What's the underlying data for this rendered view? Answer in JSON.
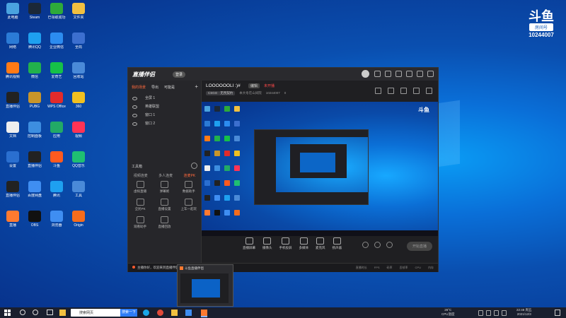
{
  "desktop": {
    "icons": [
      {
        "label": "此电脑",
        "color": "#4aa3df"
      },
      {
        "label": "Steam",
        "color": "#1b2838"
      },
      {
        "label": "已领取成功",
        "color": "#2eaa3a"
      },
      {
        "label": "文件夹",
        "color": "#f2c040"
      },
      {
        "label": "网络",
        "color": "#2b7bd6"
      },
      {
        "label": "腾讯QQ",
        "color": "#1ea0f0"
      },
      {
        "label": "企业微信",
        "color": "#2c8cf0"
      },
      {
        "label": "全局",
        "color": "#3c6fcf"
      },
      {
        "label": "腾讯视频",
        "color": "#ff7a16"
      },
      {
        "label": "微信",
        "color": "#22b14c"
      },
      {
        "label": "爱奇艺",
        "color": "#16c048"
      },
      {
        "label": "回收站",
        "color": "#4a8ad8"
      },
      {
        "label": "直播伴侣",
        "color": "#222"
      },
      {
        "label": "PUBG",
        "color": "#c8952a"
      },
      {
        "label": "WPS Office",
        "color": "#e22b2b"
      },
      {
        "label": "360",
        "color": "#f0c020"
      },
      {
        "label": "文档",
        "color": "#eeeeee"
      },
      {
        "label": "控制面板",
        "color": "#3d8ee0"
      },
      {
        "label": "应用",
        "color": "#22aa66"
      },
      {
        "label": "视频",
        "color": "#ff3355"
      },
      {
        "label": "设置",
        "color": "#2a6fd0"
      },
      {
        "label": "直播伴侣",
        "color": "#222"
      },
      {
        "label": "斗鱼",
        "color": "#ff5a1f"
      },
      {
        "label": "QQ音乐",
        "color": "#1fbf72"
      },
      {
        "label": "直播伴侣",
        "color": "#222"
      },
      {
        "label": "百度网盘",
        "color": "#3f8ef2"
      },
      {
        "label": "腾讯",
        "color": "#1ea0f0"
      },
      {
        "label": "工具",
        "color": "#4a8ad8"
      },
      {
        "label": "直播",
        "color": "#ff7a30"
      },
      {
        "label": "OBS",
        "color": "#111"
      },
      {
        "label": "浏览器",
        "color": "#3f8ef2"
      },
      {
        "label": "Origin",
        "color": "#f56c1c"
      }
    ],
    "douyu_logo": "斗鱼",
    "douyu_room_label": "房间号",
    "douyu_room_number": "10244007"
  },
  "app": {
    "brand": "直播伴侣",
    "login_badge": "登录",
    "left_tabs": [
      "我的场景",
      "导出",
      "可能是"
    ],
    "sources": [
      "全屏 1",
      "英雄联盟",
      "窗口 1",
      "窗口 2"
    ],
    "tools_title": "工具箱",
    "modes": [
      "视频连麦",
      "多人连麦",
      "连麦PK"
    ],
    "tool_items": [
      "虚拟直播",
      "弹幕姬",
      "数据助手",
      "全民PK",
      "直播设置",
      "上车一起玩",
      "观看助手",
      "直播回放"
    ],
    "room_title": "LOOOOOOLI :)#",
    "edit_label": "编辑",
    "live_status": "未开播",
    "category": "CSGO · 无畏契约",
    "room_info": "本大冬在山间院",
    "room_id": "10244007",
    "heat": "0",
    "controls": [
      "直播屏幕",
      "摄像头",
      "手机投屏",
      "多媒体",
      "麦克风",
      "扬声器"
    ],
    "go_live": "开始直播",
    "notice": "主播你好，欢迎来到直播伴侣",
    "stats": [
      "直播时长",
      "FPS",
      "码率",
      "丢帧率",
      "CPU",
      "内存"
    ],
    "preview_logo": "斗鱼"
  },
  "thumbnail": {
    "title": "斗鱼直播伴侣"
  },
  "taskbar": {
    "search_text": "搜索网页",
    "search_button": "搜索一下",
    "weather": "26°C",
    "weather_sub": "CPU温度",
    "time": "22:48 周五",
    "date": "2021/12/3"
  }
}
